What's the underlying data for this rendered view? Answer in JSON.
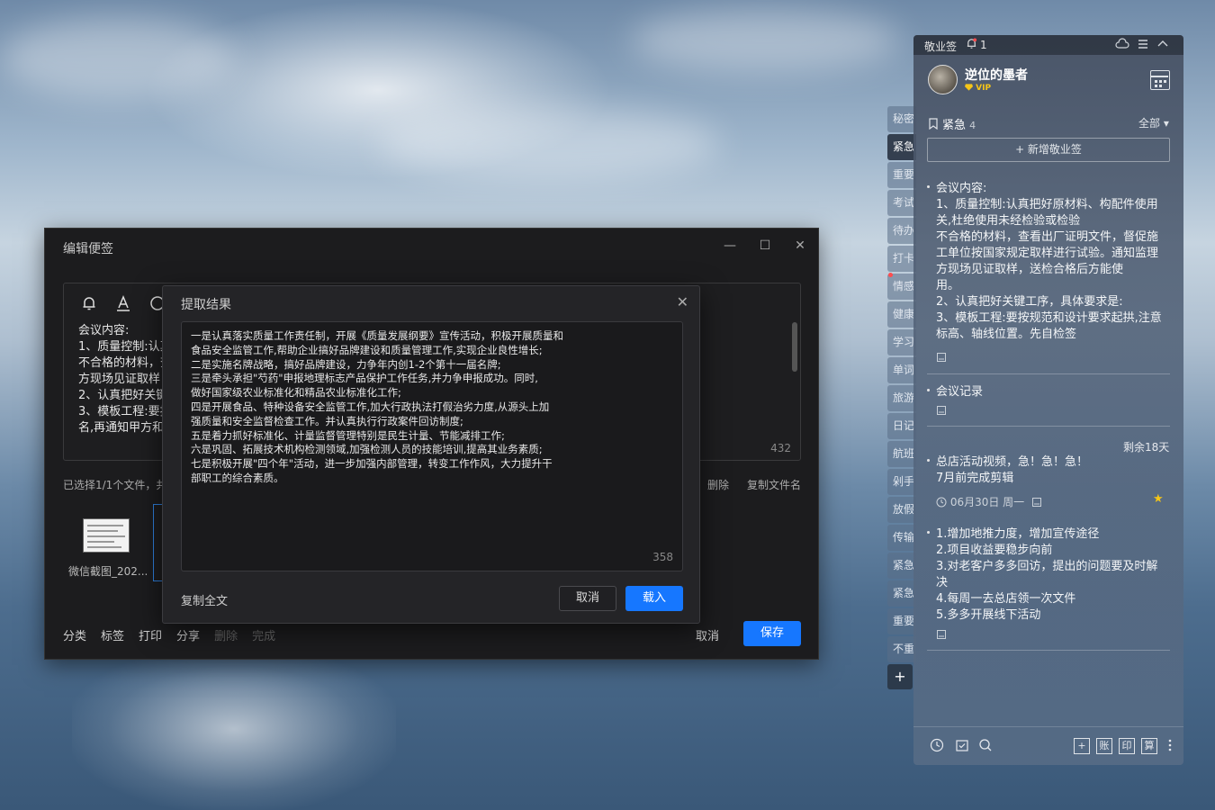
{
  "editor": {
    "title": "编辑便签",
    "min": "—",
    "max": "☐",
    "close": "✕",
    "content_lines": [
      "会议内容:",
      "1、质量控制:认真",
      "不合格的材料，查",
      "方现场见证取样",
      "2、认真把好关键",
      "3、模板工程:要按",
      "名,再通知甲方和"
    ],
    "char_count": "432",
    "file_info": "已选择1/1个文件，共",
    "delete_label": "删除",
    "copy_filename_label": "复制文件名",
    "thumb_name": "微信截图_202...",
    "bottom_actions": [
      "分类",
      "标签",
      "打印",
      "分享",
      "删除",
      "完成"
    ],
    "cancel_label": "取消",
    "save_label": "保存"
  },
  "dialog": {
    "title": "提取结果",
    "close": "✕",
    "lines": [
      "一是认真落实质量工作责任制，开展《质量发展纲要》宣传活动，积极开展质量和",
      "食品安全监管工作,帮助企业搞好品牌建设和质量管理工作,实现企业良性增长;",
      "二是实施名牌战略，搞好品牌建设，力争年内创1-2个第十一届名牌;",
      "三是牵头承担\"芍药\"申报地理标志产品保护工作任务,并力争申报成功。同时,",
      "做好国家级农业标准化和精品农业标准化工作;",
      "四是开展食品、特种设备安全监管工作,加大行政执法打假治劣力度,从源头上加",
      "强质量和安全监督检查工作。并认真执行行政案件回访制度;",
      "五是着力抓好标准化、计量监督管理特别是民生计量、节能减排工作;",
      "六是巩固、拓展技术机构检测领域,加强检测人员的技能培训,提高其业务素质;",
      "七是积极开展\"四个年\"活动，进一步加强内部管理，转变工作作风，大力提升干",
      "部职工的综合素质。"
    ],
    "char_count": "358",
    "copy_all_label": "复制全文",
    "cancel_label": "取消",
    "load_label": "载入"
  },
  "tabs": [
    "秘密",
    "紧急",
    "重要",
    "考试",
    "待办",
    "打卡",
    "情感",
    "健康",
    "学习",
    "单词",
    "旅游",
    "日记",
    "航班",
    "剁手",
    "放假",
    "传输",
    "紧急",
    "紧急",
    "重要",
    "不重"
  ],
  "tab_add": "+",
  "panel": {
    "app_name": "敬业签",
    "bell_count": "1",
    "username": "逆位的墨者",
    "vip": "VIP",
    "category": "紧急",
    "category_count": "4",
    "filter": "全部 ▾",
    "new_note": "+ 新增敬业签",
    "notes": [
      {
        "lines": [
          "会议内容:",
          "1、质量控制:认真把好原材料、构配件使用",
          "关,杜绝使用未经检验或检验",
          "不合格的材料，查看出厂证明文件，督促施",
          "工单位按国家规定取样进行试验。通知监理",
          "方现场见证取样，送检合格后方能使",
          "用。",
          "2、认真把好关键工序，具体要求是:",
          "3、模板工程:要按规范和设计要求起拱,注意",
          "标高、轴线位置。先自检签"
        ]
      },
      {
        "lines": [
          "会议记录"
        ]
      },
      {
        "remaining": "剩余18天",
        "lines": [
          "总店活动视频，急！急！急！",
          "7月前完成剪辑"
        ],
        "date": "06月30日 周一"
      },
      {
        "lines": [
          "1.增加地推力度，增加宣传途径",
          "2.项目收益要稳步向前",
          "3.对老客户多多回访，提出的问题要及时解",
          "决",
          "4.每周一去总店领一次文件",
          "5.多多开展线下活动"
        ]
      }
    ],
    "bottom_boxes": [
      "+",
      "账",
      "印",
      "算"
    ],
    "accent": "#1677ff"
  }
}
